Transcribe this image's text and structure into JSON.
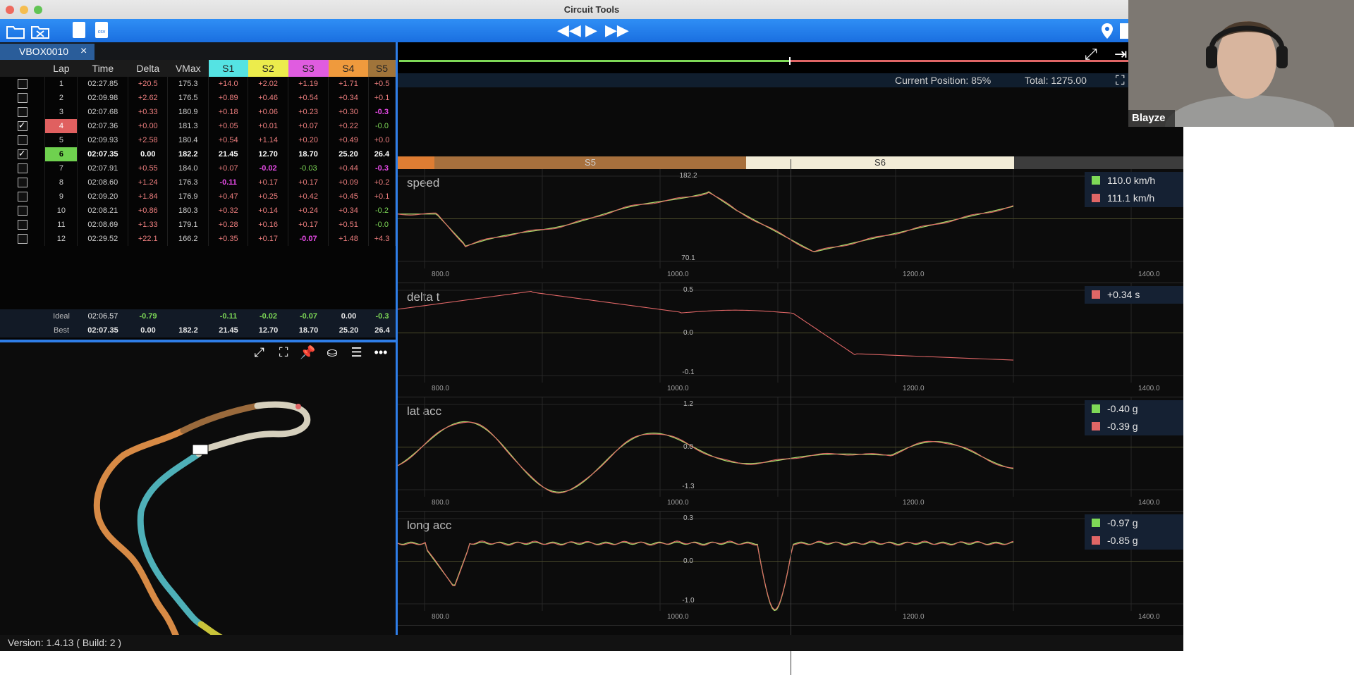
{
  "window": {
    "title": "Circuit Tools"
  },
  "toolbar": {
    "open_icon": "folder-icon",
    "close_icon": "close-file-icon",
    "sd_label": "",
    "csv_label": "csv",
    "rewind": "◀◀",
    "play": "▶",
    "forward": "▶▶"
  },
  "tab": {
    "label": "VBOX0010",
    "close": "×"
  },
  "laps": {
    "headers": [
      "Lap",
      "Time",
      "Delta",
      "VMax",
      "S1",
      "S2",
      "S3",
      "S4",
      "S5"
    ],
    "header_colors": {
      "S1": "#55e3e3",
      "S2": "#ecec4c",
      "S3": "#e05ce0",
      "S4": "#ef9a3d",
      "S5": "#a0743a"
    },
    "rows": [
      {
        "lap": "1",
        "time": "02:27.85",
        "delta": "+20.5",
        "vmax": "175.3",
        "s": [
          "+14.0",
          "+2.02",
          "+1.19",
          "+1.71",
          "+0.5"
        ],
        "checked": false,
        "highlight": ""
      },
      {
        "lap": "2",
        "time": "02:09.98",
        "delta": "+2.62",
        "vmax": "176.5",
        "s": [
          "+0.89",
          "+0.46",
          "+0.54",
          "+0.34",
          "+0.1"
        ],
        "checked": false,
        "highlight": ""
      },
      {
        "lap": "3",
        "time": "02:07.68",
        "delta": "+0.33",
        "vmax": "180.9",
        "s": [
          "+0.18",
          "+0.06",
          "+0.23",
          "+0.30",
          "-0.3"
        ],
        "checked": false,
        "highlight": ""
      },
      {
        "lap": "4",
        "time": "02:07.36",
        "delta": "+0.00",
        "vmax": "181.3",
        "s": [
          "+0.05",
          "+0.01",
          "+0.07",
          "+0.22",
          "-0.0"
        ],
        "checked": true,
        "highlight": "red"
      },
      {
        "lap": "5",
        "time": "02:09.93",
        "delta": "+2.58",
        "vmax": "180.4",
        "s": [
          "+0.54",
          "+1.14",
          "+0.20",
          "+0.49",
          "+0.0"
        ],
        "checked": false,
        "highlight": ""
      },
      {
        "lap": "6",
        "time": "02:07.35",
        "delta": "0.00",
        "vmax": "182.2",
        "s": [
          "21.45",
          "12.70",
          "18.70",
          "25.20",
          "26.4"
        ],
        "checked": true,
        "highlight": "green"
      },
      {
        "lap": "7",
        "time": "02:07.91",
        "delta": "+0.55",
        "vmax": "184.0",
        "s": [
          "+0.07",
          "-0.02",
          "-0.03",
          "+0.44",
          "-0.3"
        ],
        "checked": false,
        "highlight": ""
      },
      {
        "lap": "8",
        "time": "02:08.60",
        "delta": "+1.24",
        "vmax": "176.3",
        "s": [
          "-0.11",
          "+0.17",
          "+0.17",
          "+0.09",
          "+0.2"
        ],
        "checked": false,
        "highlight": ""
      },
      {
        "lap": "9",
        "time": "02:09.20",
        "delta": "+1.84",
        "vmax": "176.9",
        "s": [
          "+0.47",
          "+0.25",
          "+0.42",
          "+0.45",
          "+0.1"
        ],
        "checked": false,
        "highlight": ""
      },
      {
        "lap": "10",
        "time": "02:08.21",
        "delta": "+0.86",
        "vmax": "180.3",
        "s": [
          "+0.32",
          "+0.14",
          "+0.24",
          "+0.34",
          "-0.2"
        ],
        "checked": false,
        "highlight": ""
      },
      {
        "lap": "11",
        "time": "02:08.69",
        "delta": "+1.33",
        "vmax": "179.1",
        "s": [
          "+0.28",
          "+0.16",
          "+0.17",
          "+0.51",
          "-0.0"
        ],
        "checked": false,
        "highlight": ""
      },
      {
        "lap": "12",
        "time": "02:29.52",
        "delta": "+22.1",
        "vmax": "166.2",
        "s": [
          "+0.35",
          "+0.17",
          "-0.07",
          "+1.48",
          "+4.3"
        ],
        "checked": false,
        "highlight": ""
      }
    ],
    "ideal": {
      "label": "Ideal",
      "time": "02:06.57",
      "delta": "-0.79",
      "vmax": "",
      "s": [
        "-0.11",
        "-0.02",
        "-0.07",
        "0.00",
        "-0.3"
      ]
    },
    "best": {
      "label": "Best",
      "time": "02:07.35",
      "delta": "0.00",
      "vmax": "182.2",
      "s": [
        "21.45",
        "12.70",
        "18.70",
        "25.20",
        "26.4"
      ]
    }
  },
  "map_tools": {
    "expand": "⤢",
    "fit": "⛶",
    "pin": "📌",
    "bucket": "⛀",
    "menu": "☰",
    "more": "•••"
  },
  "position": {
    "current": "Current Position: 85%",
    "total": "Total: 1275.00"
  },
  "sectors": {
    "s5": "S5",
    "s6": "S6"
  },
  "charts": [
    {
      "title": "speed",
      "ymax": "182.2",
      "ymin": "70.1",
      "xticks": [
        "800.0",
        "1000.0",
        "1200.0",
        "1400.0"
      ],
      "legend": [
        {
          "color": "#7ed957",
          "value": "110.0 km/h"
        },
        {
          "color": "#e06666",
          "value": "111.1 km/h"
        }
      ]
    },
    {
      "title": "delta t",
      "ymax": "0.5",
      "ymid": "0.0",
      "ymin": "-0.1",
      "xticks": [
        "800.0",
        "1000.0",
        "1200.0",
        "1400.0"
      ],
      "legend": [
        {
          "color": "#e06666",
          "value": "+0.34 s"
        }
      ]
    },
    {
      "title": "lat acc",
      "ymax": "1.2",
      "ymid": "0.0",
      "ymin": "-1.3",
      "xticks": [
        "800.0",
        "1000.0",
        "1200.0",
        "1400.0"
      ],
      "legend": [
        {
          "color": "#7ed957",
          "value": "-0.40 g"
        },
        {
          "color": "#e06666",
          "value": "-0.39 g"
        }
      ]
    },
    {
      "title": "long acc",
      "ymax": "0.3",
      "ymid": "0.0",
      "ymin": "-1.0",
      "xticks": [
        "800.0",
        "1000.0",
        "1200.0",
        "1400.0"
      ],
      "legend": [
        {
          "color": "#7ed957",
          "value": "-0.97 g"
        },
        {
          "color": "#e06666",
          "value": "-0.85 g"
        }
      ]
    }
  ],
  "status": {
    "version": "Version: 1.4.13 ( Build: 2 )"
  },
  "webcam": {
    "name": "Blayze"
  }
}
